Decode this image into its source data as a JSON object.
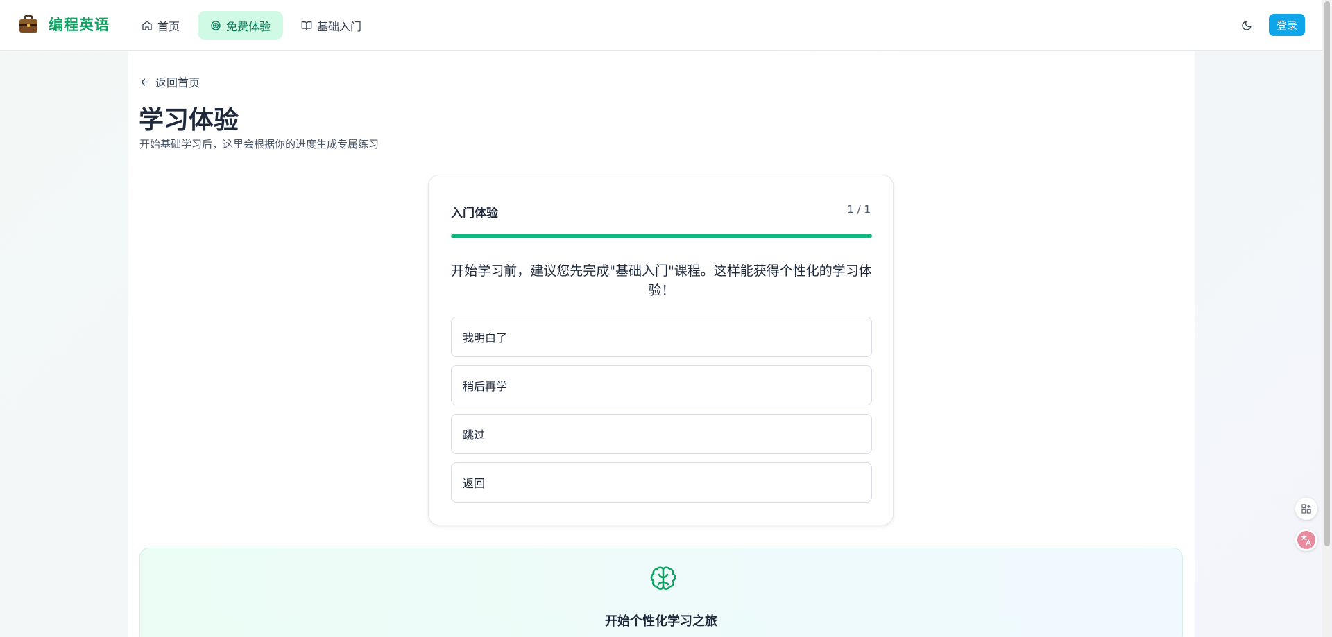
{
  "header": {
    "logo_text": "编程英语",
    "nav": [
      {
        "label": "首页",
        "icon": "home-icon"
      },
      {
        "label": "免费体验",
        "icon": "target-icon",
        "active": true
      },
      {
        "label": "基础入门",
        "icon": "book-icon"
      }
    ],
    "login_label": "登录"
  },
  "main": {
    "back_label": "返回首页",
    "title": "学习体验",
    "subtitle": "开始基础学习后，这里会根据你的进度生成专属练习"
  },
  "card": {
    "title": "入门体验",
    "count": "1 / 1",
    "progress": 1.0,
    "question": "开始学习前，建议您先完成\"基础入门\"课程。这样能获得个性化的学习体验！",
    "options": [
      "我明白了",
      "稍后再学",
      "跳过",
      "返回"
    ]
  },
  "promo": {
    "title": "开始个性化学习之旅",
    "icon": "brain-icon"
  },
  "colors": {
    "brand": "#10a163",
    "accent": "#10b981",
    "login": "#0ea5e9"
  }
}
